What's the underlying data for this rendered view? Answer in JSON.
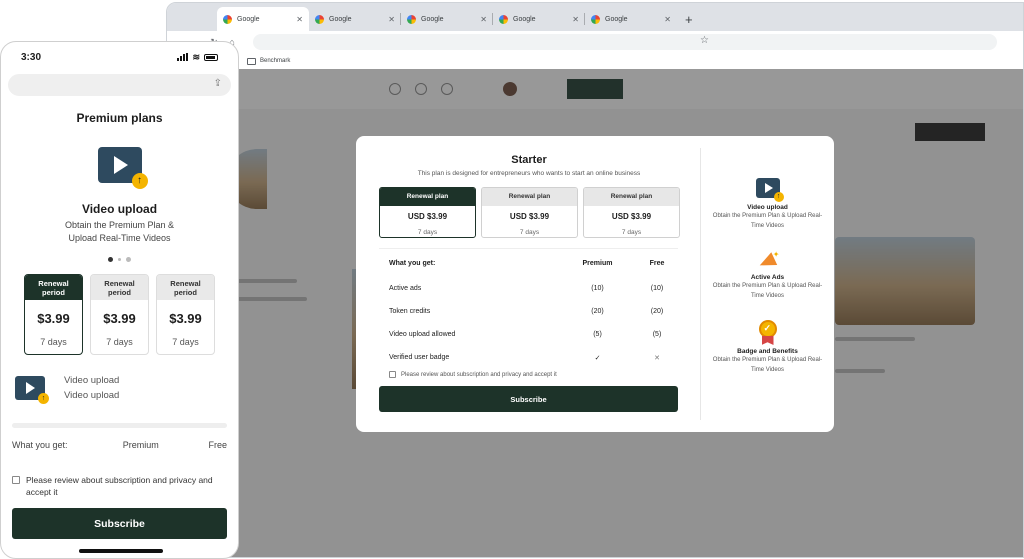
{
  "browser": {
    "tabs": [
      {
        "label": "Google"
      },
      {
        "label": "Google"
      },
      {
        "label": "Google"
      },
      {
        "label": "Google"
      },
      {
        "label": "Google"
      }
    ],
    "bookmark": "Benchmark"
  },
  "modal": {
    "title": "Starter",
    "subtitle": "This plan is designed for entrepreneurs who wants to start an online business",
    "plans": [
      {
        "label": "Renewal plan",
        "price": "USD $3.99",
        "days": "7 days",
        "selected": true
      },
      {
        "label": "Renewal plan",
        "price": "USD $3.99",
        "days": "7 days",
        "selected": false
      },
      {
        "label": "Renewal plan",
        "price": "USD $3.99",
        "days": "7 days",
        "selected": false
      }
    ],
    "table": {
      "headers": [
        "What you get:",
        "Premium",
        "Free"
      ],
      "rows": [
        {
          "feature": "Active ads",
          "premium": "(10)",
          "free": "(10)"
        },
        {
          "feature": "Token credits",
          "premium": "(20)",
          "free": "(20)"
        },
        {
          "feature": "Video upload allowed",
          "premium": "(5)",
          "free": "(5)"
        },
        {
          "feature": "Verified user badge",
          "premium": "✓",
          "free": "✕"
        }
      ]
    },
    "agree": "Please review about subscription and privacy and accept it",
    "button": "Subscribe",
    "features": [
      {
        "icon": "video-upload-icon",
        "title": "Video upload",
        "desc": "Obtain the Premium Plan & Upload Real-Time Videos"
      },
      {
        "icon": "megaphone-icon",
        "title": "Active Ads",
        "desc": "Obtain the Premium Plan & Upload Real-Time Videos"
      },
      {
        "icon": "medal-icon",
        "title": "Badge and Benefits",
        "desc": "Obtain the Premium Plan & Upload Real-Time Videos"
      }
    ]
  },
  "phone": {
    "time": "3:30",
    "title": "Premium plans",
    "feature_title": "Video upload",
    "feature_desc_1": "Obtain the Premium Plan &",
    "feature_desc_2": "Upload Real-Time Videos",
    "plans": [
      {
        "label_1": "Renewal",
        "label_2": "period",
        "price": "$3.99",
        "days": "7 days",
        "selected": true
      },
      {
        "label_1": "Renewal",
        "label_2": "period",
        "price": "$3.99",
        "days": "7 days",
        "selected": false
      },
      {
        "label_1": "Renewal",
        "label_2": "period",
        "price": "$3.99",
        "days": "7 days",
        "selected": false
      }
    ],
    "row_text_1": "Video upload",
    "row_text_2": "Video upload",
    "table_headers": [
      "What you get:",
      "Premium",
      "Free"
    ],
    "agree": "Please review about subscription and privacy and accept it",
    "button": "Subscribe"
  },
  "colors": {
    "primary": "#1d3329",
    "accent": "#f4b400",
    "icon_bg": "#2e4a5f"
  }
}
